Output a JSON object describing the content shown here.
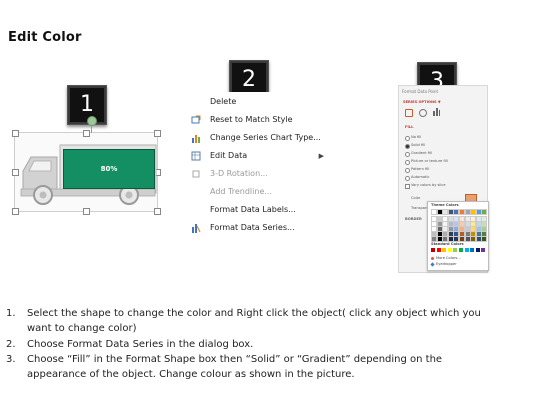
{
  "title": "Edit Color",
  "badges": [
    "1",
    "2",
    "3"
  ],
  "panel1": {
    "bar_label": "80%"
  },
  "context_menu": {
    "items": [
      {
        "icon": "delete-icon",
        "label": "Delete",
        "enabled": true
      },
      {
        "icon": "reset-style-icon",
        "label": "Reset to Match Style",
        "enabled": true
      },
      {
        "icon": "bar-chart-icon",
        "label": "Change Series Chart Type...",
        "enabled": true
      },
      {
        "icon": "edit-data-icon",
        "label": "Edit Data",
        "enabled": true,
        "submenu": true
      },
      {
        "icon": "rotation-icon",
        "label": "3-D Rotation...",
        "enabled": false
      },
      {
        "icon": "",
        "label": "Add Trendline...",
        "enabled": false
      },
      {
        "icon": "",
        "label": "Format Data Labels...",
        "enabled": true
      },
      {
        "icon": "format-series-icon",
        "label": "Format Data Series...",
        "enabled": true
      }
    ]
  },
  "format_pane": {
    "title": "Format Data Point",
    "series_options": "SERIES OPTIONS ▼",
    "fill_header": "FILL",
    "fill_options": [
      {
        "label": "No fill",
        "selected": false
      },
      {
        "label": "Solid fill",
        "selected": true
      },
      {
        "label": "Gradient fill",
        "selected": false
      },
      {
        "label": "Picture or texture fill",
        "selected": false
      },
      {
        "label": "Pattern fill",
        "selected": false
      },
      {
        "label": "Automatic",
        "selected": false
      }
    ],
    "vary_colors": "Vary colors by slice",
    "color_label": "Color",
    "transparency_label": "Transparency",
    "border_label": "BORDER"
  },
  "color_picker": {
    "theme_title": "Theme Colors",
    "standard_title": "Standard Colors",
    "more_colors": "More Colors...",
    "eyedropper": "Eyedropper",
    "theme_top": [
      "#ffffff",
      "#000000",
      "#e7e6e6",
      "#44546a",
      "#4472c4",
      "#ed7d31",
      "#a5a5a5",
      "#ffc000",
      "#5b9bd5",
      "#70ad47"
    ],
    "standard": [
      "#c00000",
      "#ff0000",
      "#ffc000",
      "#ffff00",
      "#92d050",
      "#00b050",
      "#00b0f0",
      "#0070c0",
      "#002060",
      "#7030a0"
    ],
    "accent": "#0b7a4b"
  },
  "instructions": [
    {
      "num": "1.",
      "lines": [
        "Select the shape to change the color and Right click the object( click any object which you",
        "want to change color)"
      ]
    },
    {
      "num": "2.",
      "lines": [
        "Choose Format Data Series in the dialog box."
      ]
    },
    {
      "num": "3.",
      "lines": [
        "Choose “Fill” in the Format Shape box then “Solid” or “Gradient” depending on the",
        "appearance of the object. Change colour as shown in the picture."
      ]
    }
  ]
}
